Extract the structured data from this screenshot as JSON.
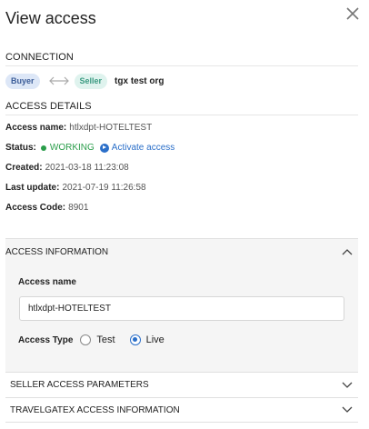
{
  "dialog": {
    "title": "View access",
    "close_icon": "close-icon"
  },
  "connection": {
    "section_title": "CONNECTION",
    "buyer_badge": "Buyer",
    "seller_badge": "Seller",
    "org_name": "tgx test org",
    "colors": {
      "buyer_bg": "#dde7f7",
      "seller_bg": "#dff3ee"
    }
  },
  "details": {
    "section_title": "ACCESS DETAILS",
    "access_name_label": "Access name:",
    "access_name_value": "htlxdpt-HOTELTEST",
    "status_label": "Status:",
    "status_value": "WORKING",
    "activate_label": "Activate access",
    "created_label": "Created:",
    "created_value": "2021-03-18 11:23:08",
    "last_update_label": "Last update:",
    "last_update_value": "2021-07-19 11:26:58",
    "access_code_label": "Access Code:",
    "access_code_value": "8901",
    "colors": {
      "status": "#2a9d4a",
      "link": "#2b6fc9"
    }
  },
  "access_information": {
    "title": "ACCESS INFORMATION",
    "expanded": true,
    "access_name_label": "Access name",
    "access_name_value": "htlxdpt-HOTELTEST",
    "access_type_label": "Access Type",
    "options": [
      "Test",
      "Live"
    ],
    "selected": "Live"
  },
  "accordions": [
    {
      "title": "SELLER ACCESS PARAMETERS",
      "expanded": false
    },
    {
      "title": "TRAVELGATEX ACCESS INFORMATION",
      "expanded": false
    }
  ]
}
